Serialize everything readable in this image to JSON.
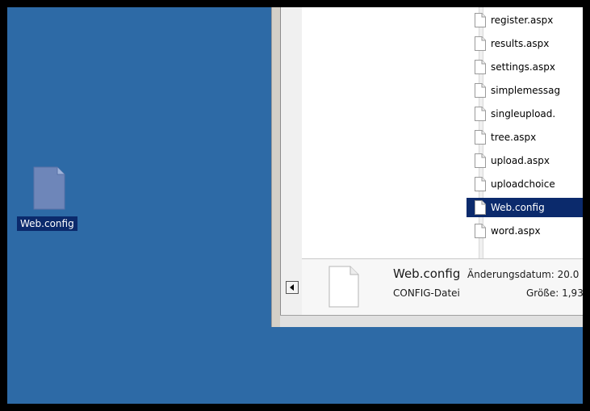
{
  "colors": {
    "desktop": "#2D6AA6",
    "selection": "#0B2A6C",
    "frame": "#000000"
  },
  "desktop": {
    "icon": {
      "label": "Web.config",
      "icon_name": "document-icon"
    }
  },
  "explorer": {
    "files": [
      {
        "name": "register.aspx"
      },
      {
        "name": "results.aspx"
      },
      {
        "name": "settings.aspx"
      },
      {
        "name": "simplemessag"
      },
      {
        "name": "singleupload."
      },
      {
        "name": "tree.aspx"
      },
      {
        "name": "upload.aspx"
      },
      {
        "name": "uploadchoice"
      },
      {
        "name": "Web.config",
        "selected": true
      },
      {
        "name": "word.aspx"
      }
    ],
    "details": {
      "file_name": "Web.config",
      "file_type": "CONFIG-Datei",
      "modified_label": "Änderungsdatum: 20.0",
      "size_label": "Größe: 1,93"
    }
  }
}
